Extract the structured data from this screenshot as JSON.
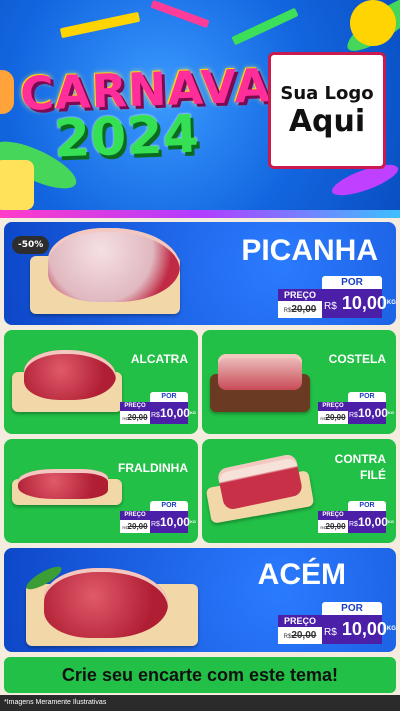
{
  "header": {
    "title_line1": "CARNAVAL",
    "title_line2": "2024",
    "logo_line1": "Sua Logo",
    "logo_line2": "Aqui"
  },
  "products": [
    {
      "name": "PICANHA",
      "badge": "-50%",
      "por": "POR",
      "preco": "PREÇO",
      "old_prefix": "R$",
      "old_price": "20,00",
      "currency": "R$",
      "price": "10,00",
      "unit": "KG"
    },
    {
      "name": "ALCATRA",
      "por": "POR",
      "preco": "PREÇO",
      "old_prefix": "R$",
      "old_price": "20,00",
      "currency": "R$",
      "price": "10,00",
      "unit": "KG"
    },
    {
      "name": "COSTELA",
      "por": "POR",
      "preco": "PREÇO",
      "old_prefix": "R$",
      "old_price": "20,00",
      "currency": "R$",
      "price": "10,00",
      "unit": "KG"
    },
    {
      "name": "FRALDINHA",
      "por": "POR",
      "preco": "PREÇO",
      "old_prefix": "R$",
      "old_price": "20,00",
      "currency": "R$",
      "price": "10,00",
      "unit": "KG"
    },
    {
      "name": "CONTRA FILÉ",
      "por": "POR",
      "preco": "PREÇO",
      "old_prefix": "R$",
      "old_price": "20,00",
      "currency": "R$",
      "price": "10,00",
      "unit": "KG"
    },
    {
      "name": "ACÉM",
      "por": "POR",
      "preco": "PREÇO",
      "old_prefix": "R$",
      "old_price": "20,00",
      "currency": "R$",
      "price": "10,00",
      "unit": "KG"
    }
  ],
  "footer": {
    "cta": "Crie seu encarte com este tema!",
    "disclaimer": "*Imagens Meramente Ilustrativas"
  }
}
